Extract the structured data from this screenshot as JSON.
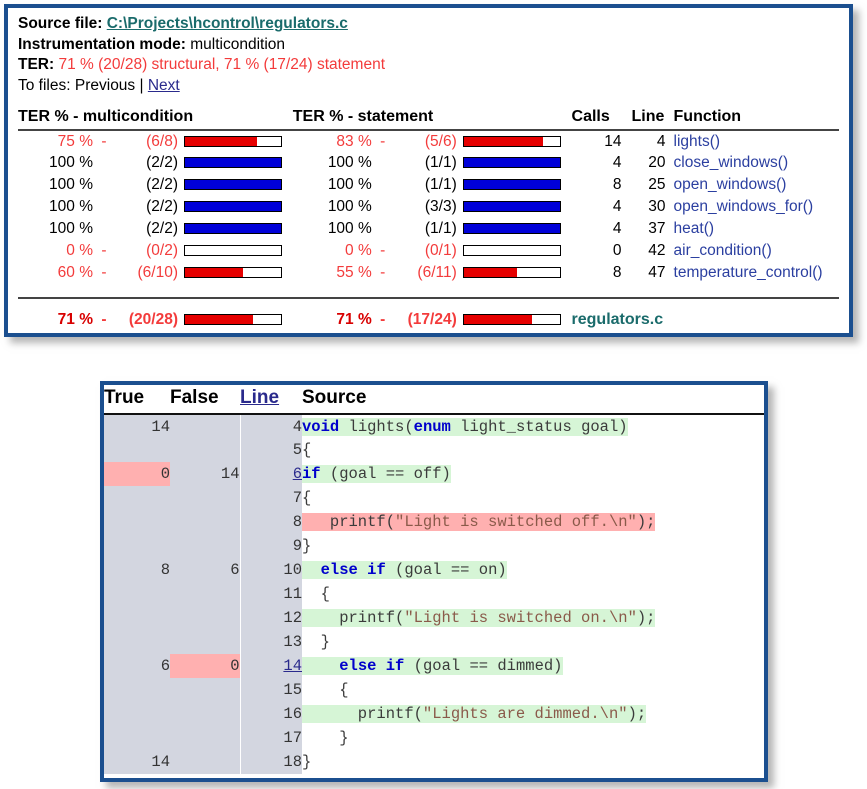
{
  "summary": {
    "source_file_label": "Source file:",
    "source_file_value": "C:\\Projects\\hcontrol\\regulators.c",
    "instrumentation_label": "Instrumentation mode:",
    "instrumentation_value": "multicondition",
    "ter_label": "TER:",
    "ter_value": "71 % (20/28) structural, 71 % (17/24) statement",
    "tofiles_label": "To files:",
    "tofiles_previous": "Previous",
    "tofiles_separator": "|",
    "tofiles_next": "Next",
    "headers": {
      "multicondition": "TER % - multicondition",
      "statement": "TER % - statement",
      "calls": "Calls",
      "line": "Line",
      "function": "Function"
    },
    "rows": [
      {
        "mc_pct": "75 %",
        "mc_dash": "-",
        "mc_frac": "(6/8)",
        "mc_fill": 75,
        "mc_state": "part",
        "st_pct": "83 %",
        "st_dash": "-",
        "st_frac": "(5/6)",
        "st_fill": 83,
        "st_state": "part",
        "calls": "14",
        "line": "4",
        "function": "lights()",
        "red": true
      },
      {
        "mc_pct": "100 %",
        "mc_dash": "",
        "mc_frac": "(2/2)",
        "mc_fill": 100,
        "mc_state": "full",
        "st_pct": "100 %",
        "st_dash": "",
        "st_frac": "(1/1)",
        "st_fill": 100,
        "st_state": "full",
        "calls": "4",
        "line": "20",
        "function": "close_windows()",
        "red": false
      },
      {
        "mc_pct": "100 %",
        "mc_dash": "",
        "mc_frac": "(2/2)",
        "mc_fill": 100,
        "mc_state": "full",
        "st_pct": "100 %",
        "st_dash": "",
        "st_frac": "(1/1)",
        "st_fill": 100,
        "st_state": "full",
        "calls": "8",
        "line": "25",
        "function": "open_windows()",
        "red": false
      },
      {
        "mc_pct": "100 %",
        "mc_dash": "",
        "mc_frac": "(2/2)",
        "mc_fill": 100,
        "mc_state": "full",
        "st_pct": "100 %",
        "st_dash": "",
        "st_frac": "(3/3)",
        "st_fill": 100,
        "st_state": "full",
        "calls": "4",
        "line": "30",
        "function": "open_windows_for()",
        "red": false
      },
      {
        "mc_pct": "100 %",
        "mc_dash": "",
        "mc_frac": "(2/2)",
        "mc_fill": 100,
        "mc_state": "full",
        "st_pct": "100 %",
        "st_dash": "",
        "st_frac": "(1/1)",
        "st_fill": 100,
        "st_state": "full",
        "calls": "4",
        "line": "37",
        "function": "heat()",
        "red": false
      },
      {
        "mc_pct": "0 %",
        "mc_dash": "-",
        "mc_frac": "(0/2)",
        "mc_fill": 0,
        "mc_state": "part",
        "st_pct": "0 %",
        "st_dash": "-",
        "st_frac": "(0/1)",
        "st_fill": 0,
        "st_state": "part",
        "calls": "0",
        "line": "42",
        "function": "air_condition()",
        "red": true
      },
      {
        "mc_pct": "60 %",
        "mc_dash": "-",
        "mc_frac": "(6/10)",
        "mc_fill": 60,
        "mc_state": "part",
        "st_pct": "55 %",
        "st_dash": "-",
        "st_frac": "(6/11)",
        "st_fill": 55,
        "st_state": "part",
        "calls": "8",
        "line": "47",
        "function": "temperature_control()",
        "red": true
      }
    ],
    "total": {
      "mc_pct": "71 %",
      "mc_dash": "-",
      "mc_frac": "(20/28)",
      "mc_fill": 71,
      "st_pct": "71 %",
      "st_dash": "-",
      "st_frac": "(17/24)",
      "st_fill": 71,
      "file": "regulators.c"
    }
  },
  "source": {
    "headers": {
      "true": "True",
      "false": "False",
      "line": "Line",
      "source": "Source"
    },
    "lines": [
      {
        "true": "14",
        "false": "",
        "true_zero": false,
        "false_zero": false,
        "line": "4",
        "line_link": false,
        "code": "void lights(enum light_status goal)",
        "hl": "green"
      },
      {
        "true": "",
        "false": "",
        "true_zero": false,
        "false_zero": false,
        "line": "5",
        "line_link": false,
        "code": "{",
        "hl": "none"
      },
      {
        "true": "0",
        "false": "14",
        "true_zero": true,
        "false_zero": false,
        "line": "6",
        "line_link": true,
        "code": "if (goal == off)",
        "hl": "green"
      },
      {
        "true": "",
        "false": "",
        "true_zero": false,
        "false_zero": false,
        "line": "7",
        "line_link": false,
        "code": "{",
        "hl": "none"
      },
      {
        "true": "",
        "false": "",
        "true_zero": false,
        "false_zero": false,
        "line": "8",
        "line_link": false,
        "code": "   printf(\"Light is switched off.\\n\");",
        "hl": "red"
      },
      {
        "true": "",
        "false": "",
        "true_zero": false,
        "false_zero": false,
        "line": "9",
        "line_link": false,
        "code": "}",
        "hl": "none"
      },
      {
        "true": "8",
        "false": "6",
        "true_zero": false,
        "false_zero": false,
        "line": "10",
        "line_link": false,
        "code": "  else if (goal == on)",
        "hl": "green"
      },
      {
        "true": "",
        "false": "",
        "true_zero": false,
        "false_zero": false,
        "line": "11",
        "line_link": false,
        "code": "  {",
        "hl": "none"
      },
      {
        "true": "",
        "false": "",
        "true_zero": false,
        "false_zero": false,
        "line": "12",
        "line_link": false,
        "code": "    printf(\"Light is switched on.\\n\");",
        "hl": "green"
      },
      {
        "true": "",
        "false": "",
        "true_zero": false,
        "false_zero": false,
        "line": "13",
        "line_link": false,
        "code": "  }",
        "hl": "none"
      },
      {
        "true": "6",
        "false": "0",
        "true_zero": false,
        "false_zero": true,
        "line": "14",
        "line_link": true,
        "code": "    else if (goal == dimmed)",
        "hl": "green"
      },
      {
        "true": "",
        "false": "",
        "true_zero": false,
        "false_zero": false,
        "line": "15",
        "line_link": false,
        "code": "    {",
        "hl": "none"
      },
      {
        "true": "",
        "false": "",
        "true_zero": false,
        "false_zero": false,
        "line": "16",
        "line_link": false,
        "code": "      printf(\"Lights are dimmed.\\n\");",
        "hl": "green"
      },
      {
        "true": "",
        "false": "",
        "true_zero": false,
        "false_zero": false,
        "line": "17",
        "line_link": false,
        "code": "    }",
        "hl": "none"
      },
      {
        "true": "14",
        "false": "",
        "true_zero": false,
        "false_zero": false,
        "line": "18",
        "line_link": false,
        "code": "}",
        "hl": "none"
      }
    ]
  },
  "colors": {
    "panel_border": "#1b4f8f",
    "red": "#f33b3b",
    "deep_red": "#d80000",
    "bar_blue": "#0000d8",
    "bar_red": "#e60000",
    "link_teal": "#1a6b6b",
    "link_blue": "#2a2a8c",
    "func_blue": "#2b3fa0",
    "gutter_gray": "#d3d6e0",
    "hl_green": "#d6f5d6",
    "hl_red": "#ffb0b0"
  }
}
